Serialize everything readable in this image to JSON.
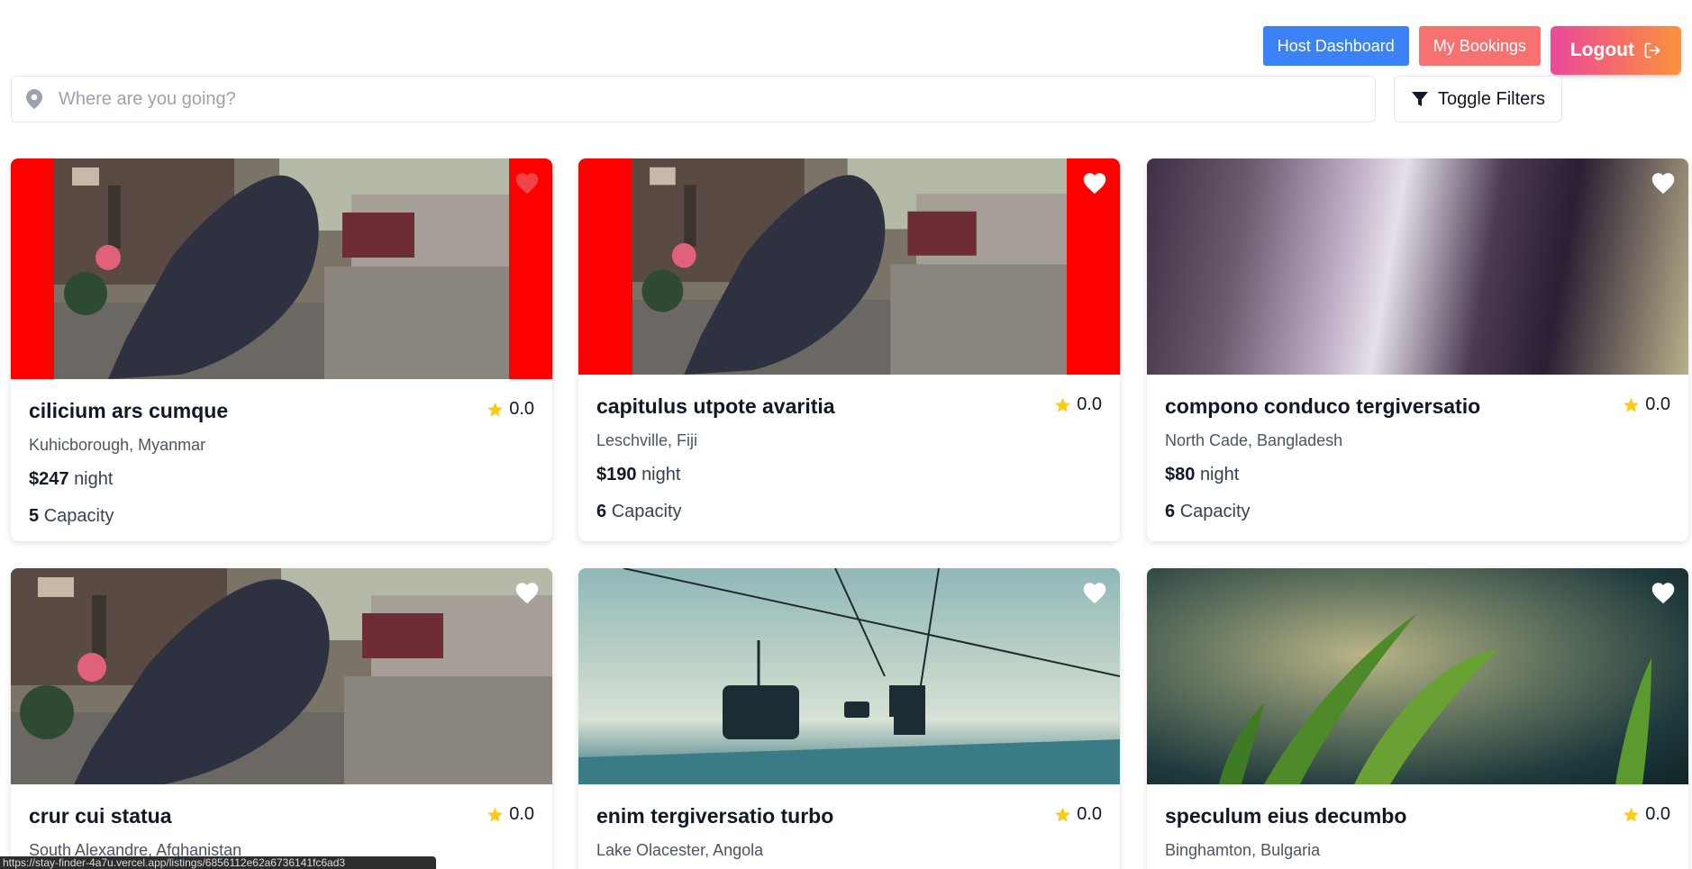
{
  "header": {
    "host_dashboard": "Host Dashboard",
    "my_bookings": "My Bookings",
    "logout": "Logout"
  },
  "search": {
    "placeholder": "Where are you going?"
  },
  "filters": {
    "toggle_label": "Toggle Filters"
  },
  "listings": [
    {
      "title": "cilicium ars cumque",
      "rating": "0.0",
      "location": "Kuhicborough, Myanmar",
      "price": "$247",
      "price_unit": "night",
      "capacity": "5",
      "capacity_label": "Capacity",
      "image": "cat-statue-street",
      "favorited": true
    },
    {
      "title": "capitulus utpote avaritia",
      "rating": "0.0",
      "location": "Leschville, Fiji",
      "price": "$190",
      "price_unit": "night",
      "capacity": "6",
      "capacity_label": "Capacity",
      "image": "cat-statue-street",
      "favorited": false
    },
    {
      "title": "compono conduco tergiversatio",
      "rating": "0.0",
      "location": "North Cade, Bangladesh",
      "price": "$80",
      "price_unit": "night",
      "capacity": "6",
      "capacity_label": "Capacity",
      "image": "blurred-purple-abstract",
      "favorited": false
    },
    {
      "title": "crur cui statua",
      "rating": "0.0",
      "location": "South Alexandre, Afghanistan",
      "image": "cat-statue-street",
      "favorited": false
    },
    {
      "title": "enim tergiversatio turbo",
      "rating": "0.0",
      "location": "Lake Olacester, Angola",
      "image": "ski-lift-fog",
      "favorited": false
    },
    {
      "title": "speculum eius decumbo",
      "rating": "0.0",
      "location": "Binghamton, Bulgaria",
      "image": "grass-closeup",
      "favorited": false
    }
  ],
  "status_bar": {
    "url": "https://stay-finder-4a7u.vercel.app/listings/6856112e62a6736141fc6ad3"
  },
  "colors": {
    "host_button": "#3b82f6",
    "bookings_button": "#f87171",
    "logout_gradient_start": "#ec4899",
    "logout_gradient_end": "#fb923c",
    "star": "#facc15",
    "heart_favorited": "#ef4444"
  }
}
